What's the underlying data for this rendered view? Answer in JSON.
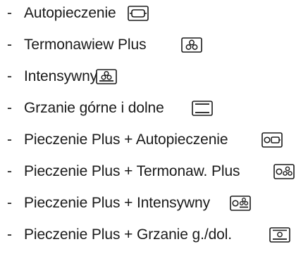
{
  "list": {
    "items": [
      {
        "dash": "-",
        "label": "Autopieczenie",
        "icon": "autoroast-icon"
      },
      {
        "dash": "-",
        "label": "Termonawiew Plus",
        "icon": "fan-plus-icon"
      },
      {
        "dash": "-",
        "label": "Intensywny",
        "icon": "intensive-icon"
      },
      {
        "dash": "-",
        "label": "Grzanie górne i dolne",
        "icon": "top-bottom-heat-icon"
      },
      {
        "dash": "-",
        "label": "Pieczenie Plus + Autopieczenie",
        "icon": "moisture-plus-autoroast-icon"
      },
      {
        "dash": "-",
        "label": "Pieczenie Plus + Termonaw. Plus",
        "icon": "moisture-plus-fan-plus-icon"
      },
      {
        "dash": "-",
        "label": "Pieczenie Plus + Intensywny",
        "icon": "moisture-plus-intensive-icon"
      },
      {
        "dash": "-",
        "label": "Pieczenie Plus + Grzanie g./dol.",
        "icon": "moisture-plus-top-bottom-heat-icon"
      }
    ]
  }
}
